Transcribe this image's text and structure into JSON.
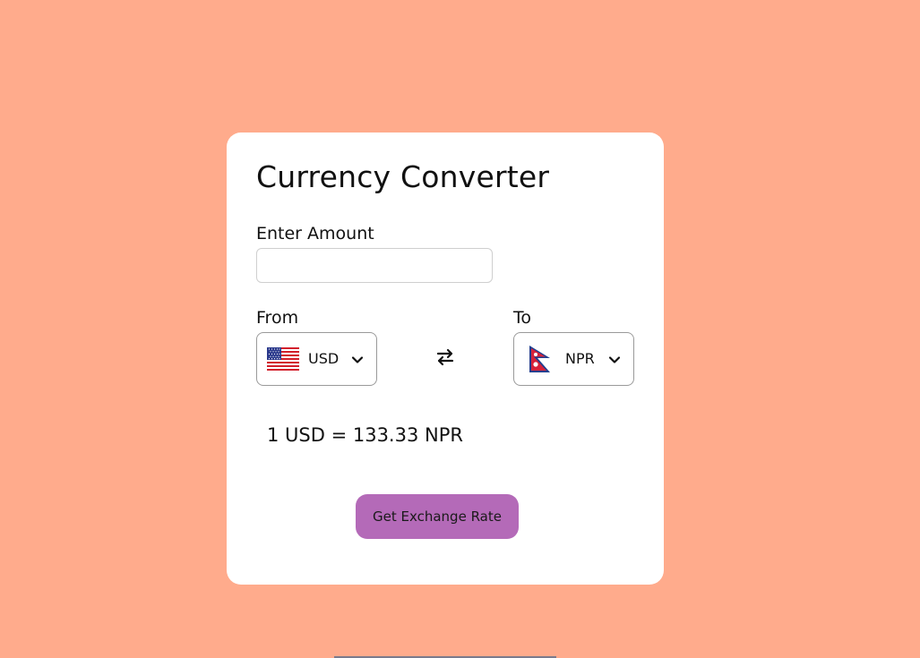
{
  "app": {
    "title": "Currency Converter",
    "background_color": "#ffab8c",
    "accent_color": "#b46ab8"
  },
  "amount": {
    "label": "Enter Amount",
    "value": "",
    "placeholder": ""
  },
  "from": {
    "label": "From",
    "currency": "USD",
    "flag_icon": "us-flag-icon"
  },
  "to": {
    "label": "To",
    "currency": "NPR",
    "flag_icon": "nepal-flag-icon"
  },
  "swap_icon": "swap-arrows-icon",
  "result": {
    "text": "1 USD = 133.33 NPR"
  },
  "button": {
    "label": "Get Exchange Rate"
  }
}
